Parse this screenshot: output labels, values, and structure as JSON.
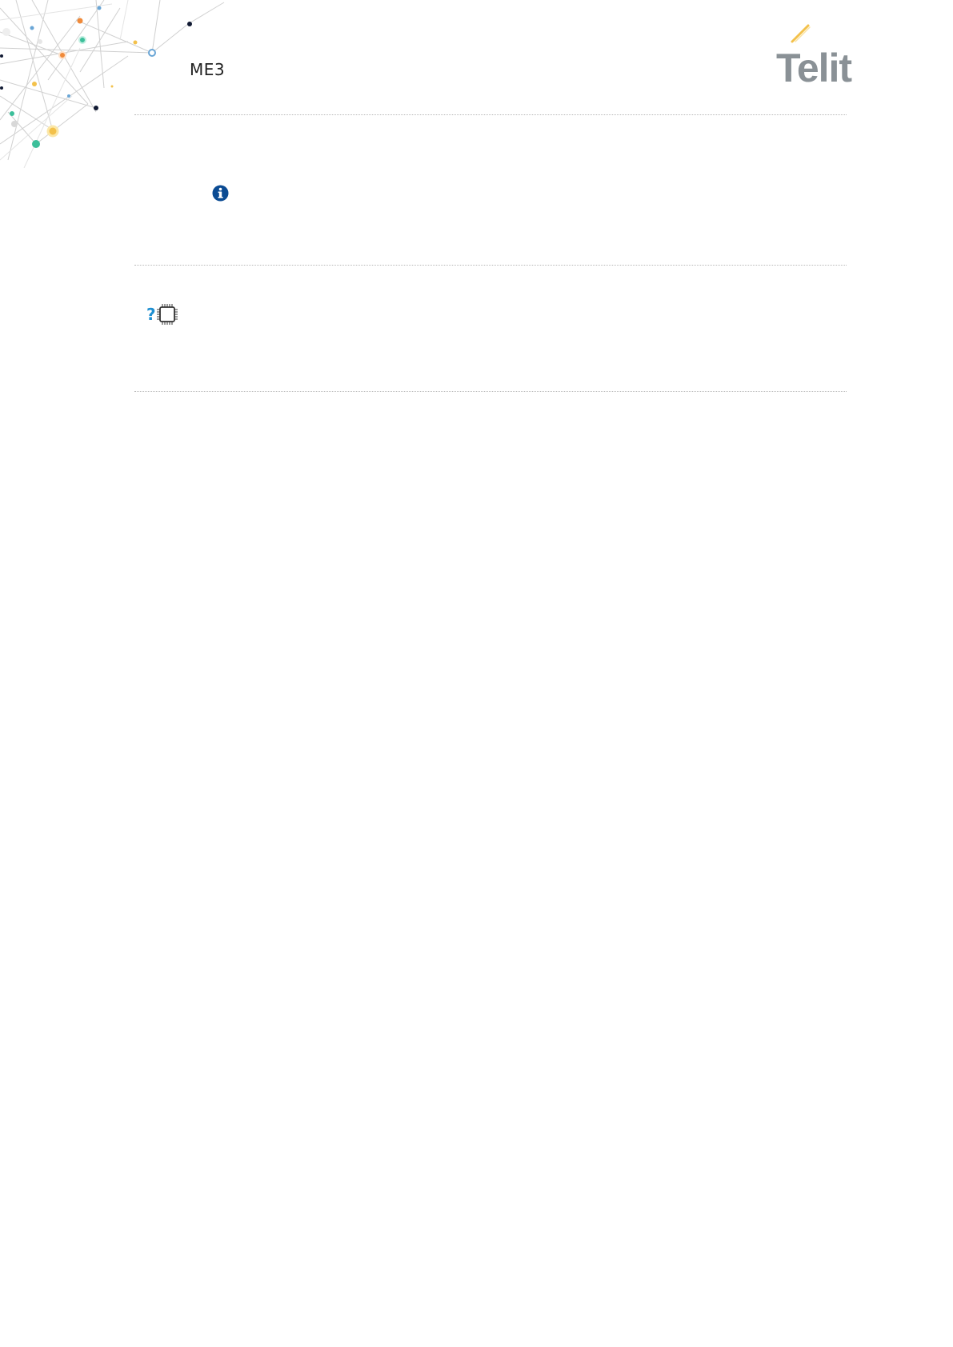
{
  "header": {
    "product_label": "ME3",
    "logo": {
      "text": "Telit",
      "color": "#8a9196",
      "accent": "#f3c14b"
    }
  },
  "notes": [
    {
      "icon": "info-icon",
      "color": "#0b4b93"
    },
    {
      "icon": "question-chip-icon",
      "color": "#1e8fd1"
    }
  ]
}
